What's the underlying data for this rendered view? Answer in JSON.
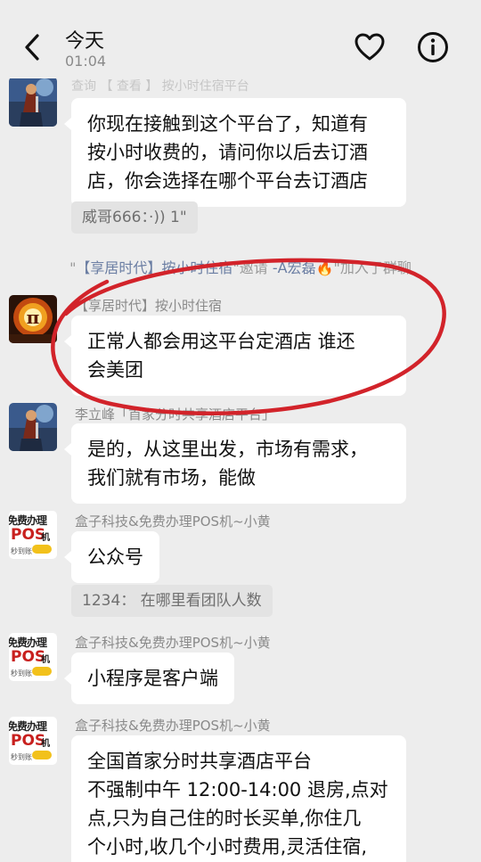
{
  "header": {
    "title": "今天",
    "subtitle": "01:04"
  },
  "messages": [
    {
      "faded_top": "查询 【 查看 】 按小时住宿平台",
      "text": "你现在接触到这个平台了，知道有\n按小时收费的，请问你以后去订酒\n店，你会选择在哪个平台去订酒店",
      "quote": "威哥666：·)) 1\""
    },
    {
      "system": {
        "prefix": "\"",
        "group": "【享居时代】按小时住宿",
        "middle": "\"邀请 ",
        "user": "-A宏磊🔥",
        "suffix": "\"加入了群聊"
      }
    },
    {
      "sender": "【享居时代】按小时住宿",
      "text": "正常人都会用这平台定酒店  谁还\n会美团"
    },
    {
      "sender": "李立峰「首家分时共享酒店平台」",
      "text": "是的，从这里出发，市场有需求，\n我们就有市场，能做"
    },
    {
      "sender": "盒子科技&免费办理POS机~小黄",
      "text": "公众号",
      "quote": "1234：  在哪里看团队人数"
    },
    {
      "sender": "盒子科技&免费办理POS机~小黄",
      "text": "小程序是客户端"
    },
    {
      "sender": "盒子科技&免费办理POS机~小黄",
      "text": "全国首家分时共享酒店平台\n不强制中午 12:00-14:00 退房,点对\n点,只为自己住的时长买单,你住几\n个小时,收几个小时费用,灵活住宿,\n随住随走 未兑 享银首退房 酒店"
    }
  ],
  "pos_avatar": {
    "line1": "免费办理",
    "line2": "POS",
    "line3": "机",
    "line4": "秒到账·"
  },
  "pi_avatar": {
    "symbol": "π"
  },
  "colors": {
    "background": "#ededed",
    "bubble": "#ffffff",
    "annotation": "#d2232a",
    "quote_bg": "#e3e3e3"
  },
  "icons": [
    "chevron-left-icon",
    "heart-icon",
    "info-icon"
  ]
}
